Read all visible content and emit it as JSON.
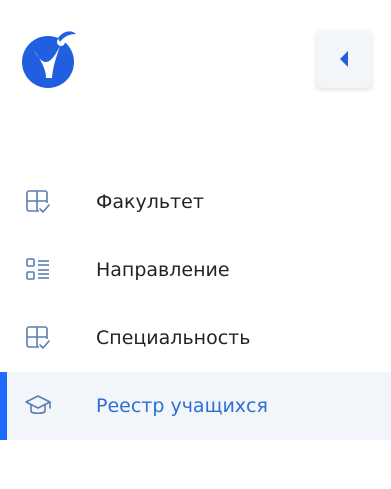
{
  "sidebar": {
    "collapse_button": {
      "icon": "caret-left-icon"
    },
    "items": [
      {
        "label": "Факультет",
        "icon": "grid-check-icon",
        "active": false
      },
      {
        "label": "Направление",
        "icon": "list-icon",
        "active": false
      },
      {
        "label": "Специальность",
        "icon": "grid-check-icon",
        "active": false
      },
      {
        "label": "Реестр учащихся",
        "icon": "graduation-cap-icon",
        "active": true
      }
    ]
  },
  "colors": {
    "accent": "#1f6bff",
    "active_text": "#2e6fd6",
    "icon": "#5a7fae",
    "active_background": "#f2f5f9"
  }
}
